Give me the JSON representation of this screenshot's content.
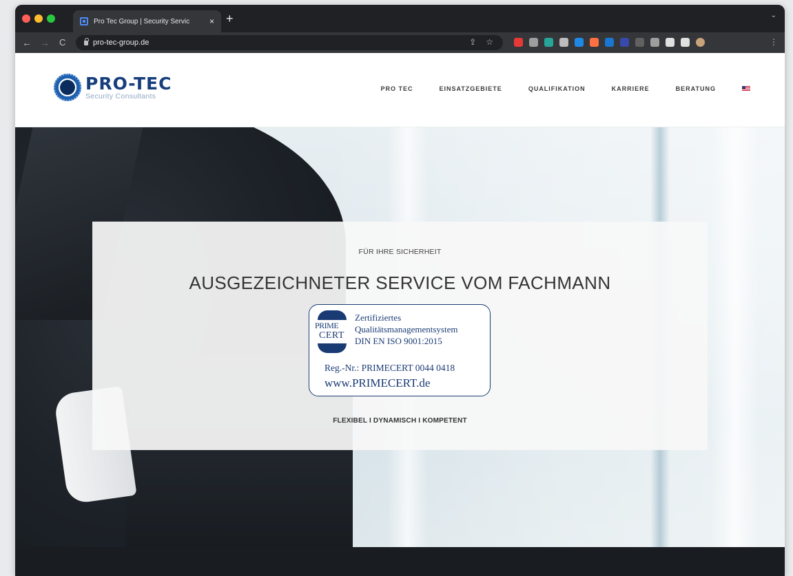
{
  "browser": {
    "tab_title": "Pro Tec Group | Security Servic",
    "tab_close": "×",
    "new_tab": "+",
    "tab_menu": "⌄",
    "url": "pro-tec-group.de",
    "back": "←",
    "forward": "→",
    "reload": "C",
    "share_icon": "⇪",
    "bookmark_icon": "☆",
    "menu": "⋮",
    "extension_colors": [
      "#e53935",
      "#9e9e9e",
      "#26a69a",
      "#bdbdbd",
      "#1e88e5",
      "#ff7043",
      "#1976d2",
      "#3949ab",
      "#616161",
      "#9e9e9e",
      "#e0e0e0",
      "#e0e0e0",
      "#c8a27a"
    ]
  },
  "site": {
    "logo_name": "PRO-TEC",
    "logo_sub": "Security Consultants",
    "nav": [
      "PRO TEC",
      "EINSATZGEBIETE",
      "QUALIFIKATION",
      "KARRIERE",
      "BERATUNG"
    ],
    "language_flag": "us-flag-icon"
  },
  "hero": {
    "kicker": "FÜR IHRE SICHERHEIT",
    "title": "AUSGEZEICHNETER SERVICE VOM FACHMANN",
    "tagline": "FLEXIBEL I DYNAMISCH I KOMPETENT",
    "cert": {
      "seal_top": "PRIME",
      "seal_bottom": "CERT",
      "line1": "Zertifiziertes",
      "line2": "Qualitätsmanagementsystem",
      "line3": "DIN EN ISO 9001:2015",
      "reg": "Reg.-Nr.: PRIMECERT 0044 0418",
      "url": "www.PRIMECERT.de"
    }
  },
  "colors": {
    "brand_blue": "#173f7c",
    "cert_blue": "#1a3a74",
    "footer": "#191d22"
  }
}
